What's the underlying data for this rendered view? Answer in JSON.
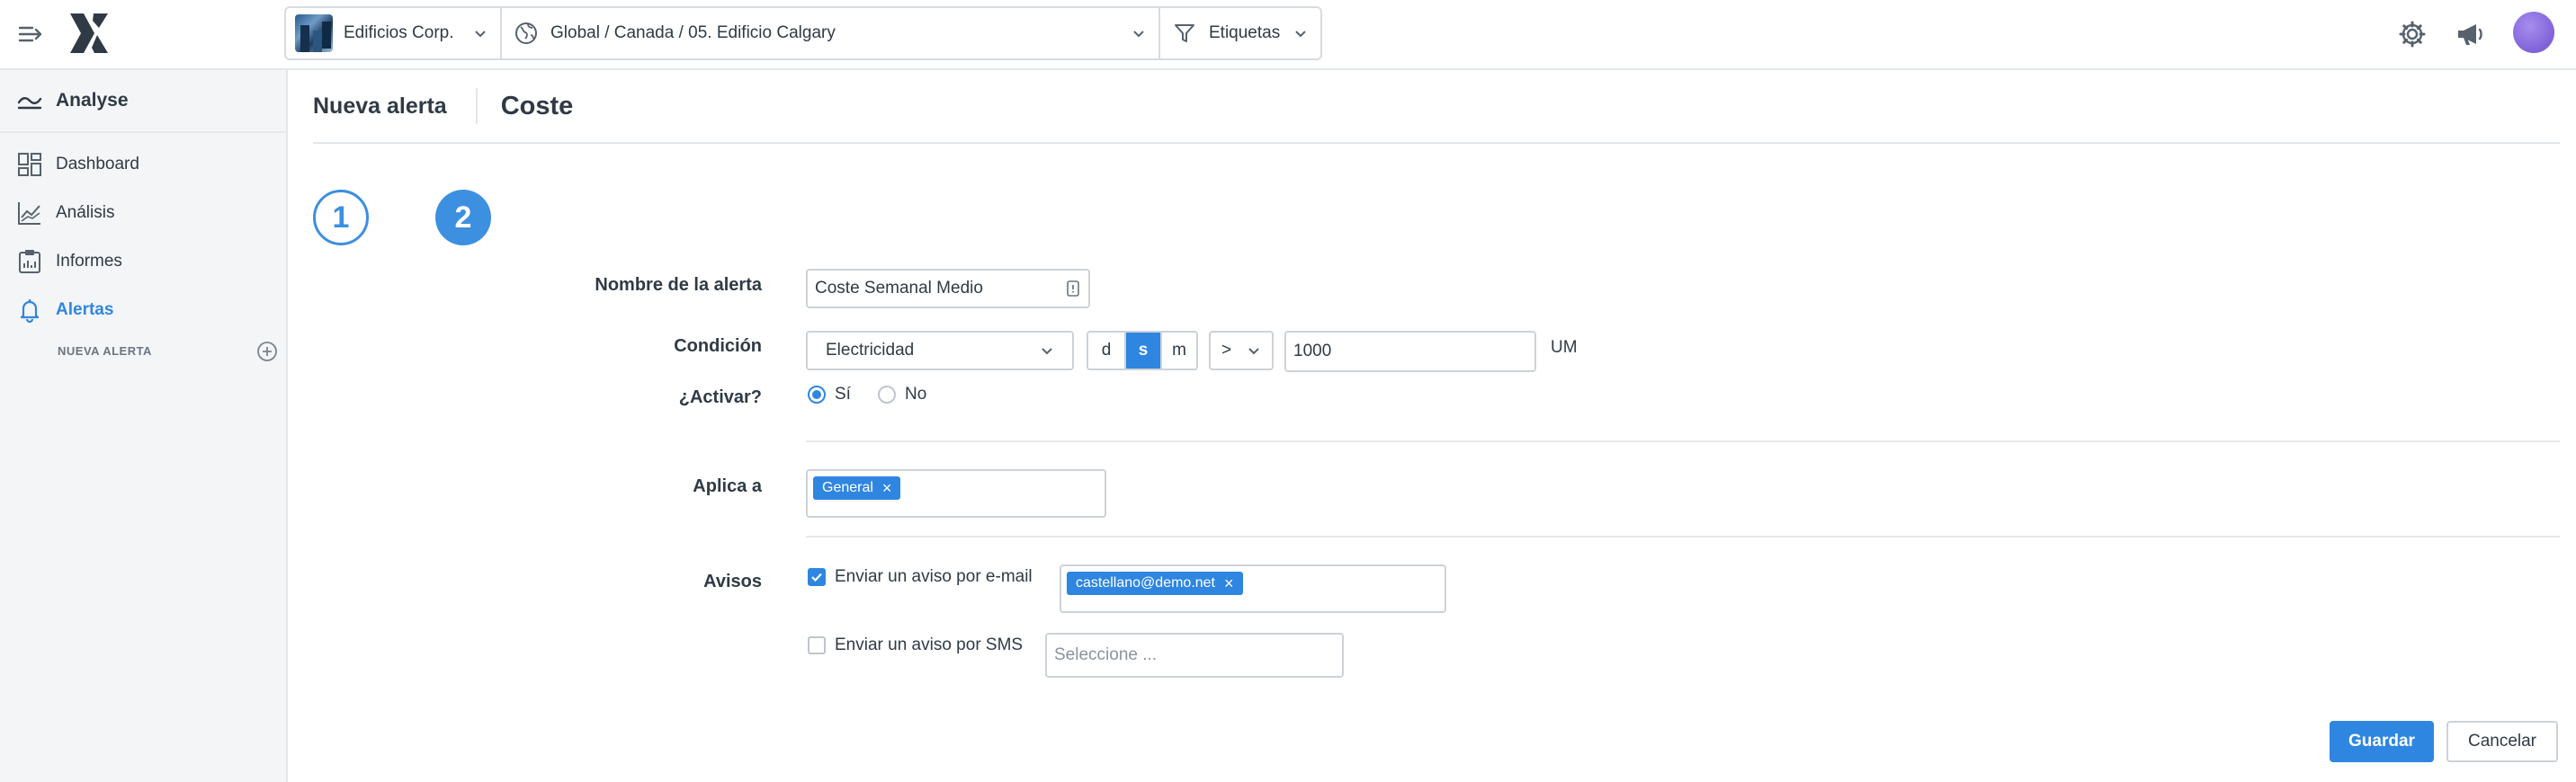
{
  "header": {
    "company": "Edificios Corp.",
    "location": "Global / Canada / 05. Edificio Calgary",
    "tags": "Etiquetas"
  },
  "sidebar": {
    "section": "Analyse",
    "items": [
      {
        "label": "Dashboard"
      },
      {
        "label": "Análisis"
      },
      {
        "label": "Informes"
      },
      {
        "label": "Alertas"
      }
    ],
    "sub_item": "NUEVA ALERTA"
  },
  "page": {
    "pre_title": "Nueva alerta",
    "title": "Coste"
  },
  "steps": [
    "1",
    "2"
  ],
  "form": {
    "name_label": "Nombre de la alerta",
    "name_value": "Coste Semanal Medio",
    "condition_label": "Condición",
    "condition_select": "Electricidad",
    "periods": [
      "d",
      "s",
      "m"
    ],
    "period_selected": "s",
    "operator": ">",
    "threshold": "1000",
    "unit": "UM",
    "activate_label": "¿Activar?",
    "activate_yes": "Sí",
    "activate_no": "No",
    "activate_value": "Sí",
    "applies_label": "Aplica a",
    "applies_tag": "General",
    "notices_label": "Avisos",
    "email_check_label": "Enviar un aviso por e-mail",
    "email_checked": true,
    "email_tag": "castellano@demo.net",
    "sms_check_label": "Enviar un aviso por SMS",
    "sms_checked": false,
    "sms_placeholder": "Seleccione ..."
  },
  "actions": {
    "save": "Guardar",
    "cancel": "Cancelar"
  },
  "icons": {
    "menu": "menu-collapse-icon",
    "logo": "logo-icon",
    "globe": "globe-icon",
    "filter": "filter-icon",
    "settings": "gear-icon",
    "announce": "megaphone-icon",
    "analyse": "analyse-icon",
    "dashboard": "dashboard-icon",
    "analysis": "chart-line-icon",
    "reports": "clipboard-icon",
    "alerts": "bell-icon",
    "add": "plus-circle-icon"
  },
  "colors": {
    "accent": "#2f86e0",
    "sidebar_bg": "#f4f5f7"
  }
}
